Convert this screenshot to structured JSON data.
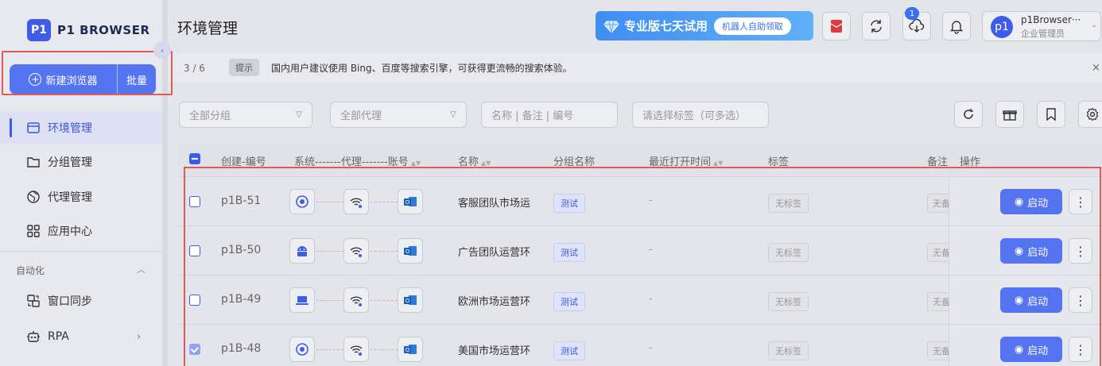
{
  "brand": {
    "logo_mark": "P1",
    "logo_text": "P1 BROWSER"
  },
  "sidebar": {
    "new_browser": "新建浏览器",
    "batch": "批量",
    "items": [
      {
        "label": "环境管理",
        "icon": "window-icon",
        "active": true
      },
      {
        "label": "分组管理",
        "icon": "folder-icon"
      },
      {
        "label": "代理管理",
        "icon": "globe-icon"
      },
      {
        "label": "应用中心",
        "icon": "apps-grid-icon"
      }
    ],
    "section_label": "自动化",
    "auto_items": [
      {
        "label": "窗口同步",
        "icon": "window-sync-icon"
      },
      {
        "label": "RPA",
        "icon": "robot-icon"
      }
    ]
  },
  "header": {
    "title": "环境管理",
    "promo_text": "专业版七天试用",
    "promo_pill": "机器人自助领取",
    "download_badge": "1",
    "user_name": "p1Browser···",
    "user_role": "企业管理员",
    "avatar_text": "p1"
  },
  "notice": {
    "counter": "3 / 6",
    "tip": "提示",
    "message": "国内用户建议使用 Bing、百度等搜索引擎，可获得更流畅的搜索体验。",
    "close": "×"
  },
  "filters": {
    "group": "全部分组",
    "proxy": "全部代理",
    "search_placeholder": "名称 | 备注 | 编号",
    "tags_placeholder": "请选择标签（可多选）"
  },
  "table": {
    "headers": {
      "code": "创建-编号",
      "chain": "系统-------代理-------账号",
      "name": "名称",
      "group": "分组名称",
      "last_open": "最近打开时间",
      "tags": "标签",
      "note": "备注",
      "ops": "操作"
    },
    "rows": [
      {
        "checked": false,
        "prefix": "p1B",
        "num": "-51",
        "system": "chrome-icon",
        "name": "客服团队市场运",
        "group": "测试",
        "last_open": "-",
        "tag": "无标签",
        "note": "无备",
        "start": "启动"
      },
      {
        "checked": false,
        "prefix": "p1B",
        "num": "-50",
        "system": "android-icon",
        "name": "广告团队运营环",
        "group": "测试",
        "last_open": "-",
        "tag": "无标签",
        "note": "无备",
        "start": "启动"
      },
      {
        "checked": false,
        "prefix": "p1B",
        "num": "-49",
        "system": "laptop-icon",
        "name": "欧洲市场运营环",
        "group": "测试",
        "last_open": "-",
        "tag": "无标签",
        "note": "无备",
        "start": "启动"
      },
      {
        "checked": true,
        "prefix": "p1B",
        "num": "-48",
        "system": "chrome-icon",
        "name": "美国市场运营环",
        "group": "测试",
        "last_open": "-",
        "tag": "无标签",
        "note": "无备",
        "start": "启动"
      }
    ]
  },
  "colors": {
    "accent": "#5575f0",
    "highlight_border": "#e05a5a",
    "promo": "#4a9af4"
  }
}
